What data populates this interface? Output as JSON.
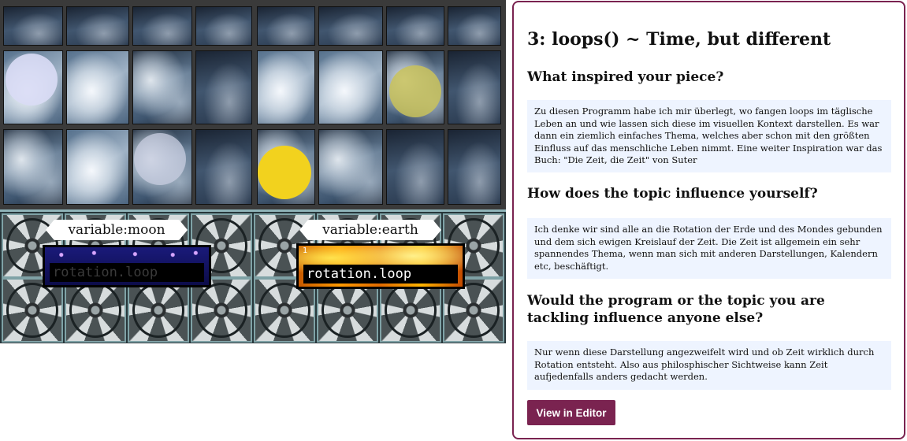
{
  "artwork": {
    "moon": {
      "variable_label": "variable:moon",
      "loop_text": "rotation.loop",
      "text_color": "#3a3a3a"
    },
    "earth": {
      "variable_label": "variable:earth",
      "loop_text": "rotation.loop",
      "loop_number": "1",
      "text_color": "#ffffff"
    },
    "colors": {
      "moon_orb": "#d9dbf5",
      "sun_orb": "#f2d21e",
      "faded_sun_orb": "#c9c25a"
    }
  },
  "panel": {
    "title": "3: loops() ~ Time, but different",
    "sections": [
      {
        "question": "What inspired your piece?",
        "answer": "Zu diesen Programm habe ich mir überlegt, wo fangen loops im täglische Leben an und wie lassen sich diese im visuellen Kontext darstellen. Es war dann ein ziemlich einfaches Thema, welches aber schon mit den größten Einfluss auf das menschliche Leben nimmt. Eine weiter Inspiration war das Buch: \"Die Zeit, die Zeit\" von Suter"
      },
      {
        "question": "How does the topic influence yourself?",
        "answer": "Ich denke wir sind alle an die Rotation der Erde und des Mondes gebunden und dem sich ewigen Kreislauf der Zeit. Die Zeit ist allgemein ein sehr spannendes Thema, wenn man sich mit anderen Darstellungen, Kalendern etc, beschäftigt."
      },
      {
        "question": "Would the program or the topic you are tackling influence anyone else?",
        "answer": "Nur wenn diese Darstellung angezweifelt wird und ob Zeit wirklich durch Rotation entsteht. Also aus philosphischer Sichtweise kann Zeit aufjedenfalls anders gedacht werden."
      }
    ],
    "editor_button_label": "View in Editor",
    "accent_color": "#7a2350",
    "answer_background": "#eef4ff"
  }
}
